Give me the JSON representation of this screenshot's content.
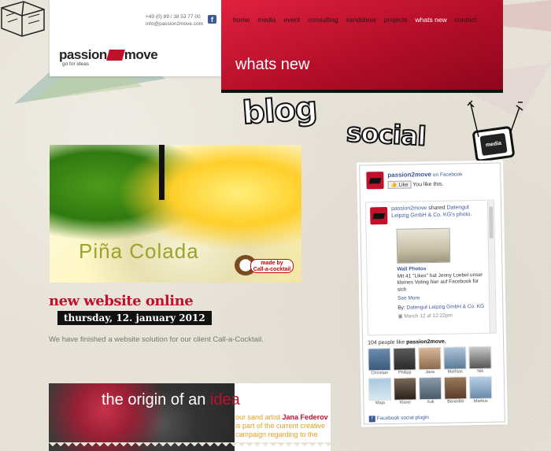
{
  "header": {
    "phone": "+49 (0) 89 / 38 53 77 00",
    "email": "info@passion2move.com",
    "logo_left": "passion",
    "logo_right": "move",
    "tagline": "go for ideas",
    "page_title": "whats new"
  },
  "nav": [
    "home",
    "media",
    "event",
    "consulting",
    "sandshow",
    "projects",
    "whats new",
    "contact"
  ],
  "headings": {
    "blog": "blog",
    "social": "social",
    "tv_label": "media"
  },
  "post": {
    "image_text": "Piña Colada",
    "badge_line1": "made by",
    "badge_line2": "Call-a-cocktail",
    "title": "new website online",
    "date": "thursday, 12. january 2012",
    "text": "We have finished a website solution for our client Call-a-Cocktail."
  },
  "origin": {
    "title_pre": "the origin of an",
    "title_hl": "idea",
    "text_pre": "our sand artist",
    "text_name": "Jana Federov",
    "text_post": "is part of the current creative campaign regarding to the"
  },
  "facebook": {
    "page_name": "passion2move",
    "on_fb": "on Facebook",
    "like": "Like",
    "you_like": "You like this.",
    "post_author": "passion2move",
    "post_action": "shared",
    "post_link": "Datengut Leipzig GmbH & Co. KG's photo.",
    "photo_title": "Wall Photos",
    "photo_desc": "Mit 41 \"Likes\" hat Jenny Loebel unser kleines Voting hier auf Facebook für sich",
    "see_more": "See More",
    "by_label": "By:",
    "by_name": "Datengut Leipzig GmbH & Co. KG",
    "post_time": "March 12 at 12:22pm",
    "count_pre": "104 people like",
    "count_name": "passion2move.",
    "faces": [
      "Christian",
      "Philipp",
      "Jana",
      "Mathias",
      "Nik",
      "Maja",
      "Klarer",
      "Xuli",
      "Benedikt",
      "Markus"
    ],
    "plugin": "Facebook social plugin"
  }
}
